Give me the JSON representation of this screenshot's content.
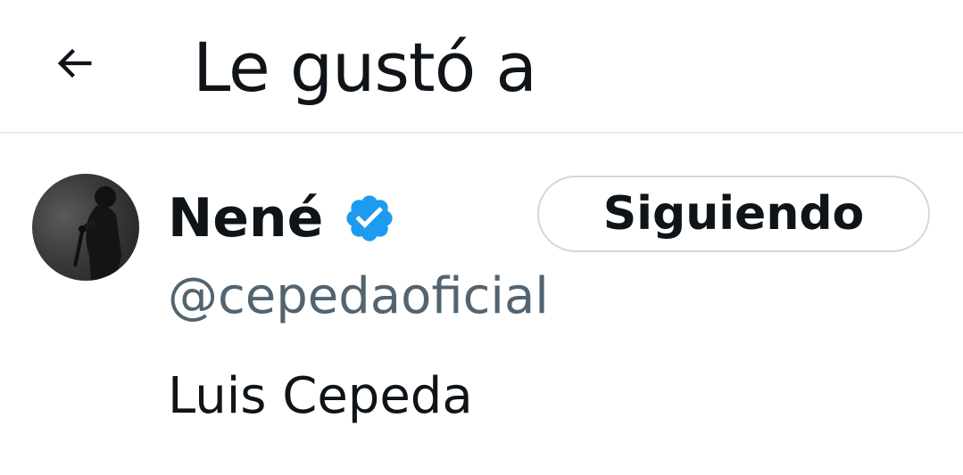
{
  "header": {
    "back_icon": "arrow-left-icon",
    "title": "Le gustó a"
  },
  "user": {
    "display_name": "Nené",
    "verified_icon": "verified-badge-icon",
    "verified_color": "#1d9bf0",
    "handle": "@cepedaoficial",
    "bio": "Luis Cepeda",
    "follow_button_label": "Siguiendo"
  },
  "colors": {
    "text_primary": "#0f1419",
    "text_secondary": "#536471",
    "border": "#cfd9de",
    "divider": "#e6ecf0"
  }
}
